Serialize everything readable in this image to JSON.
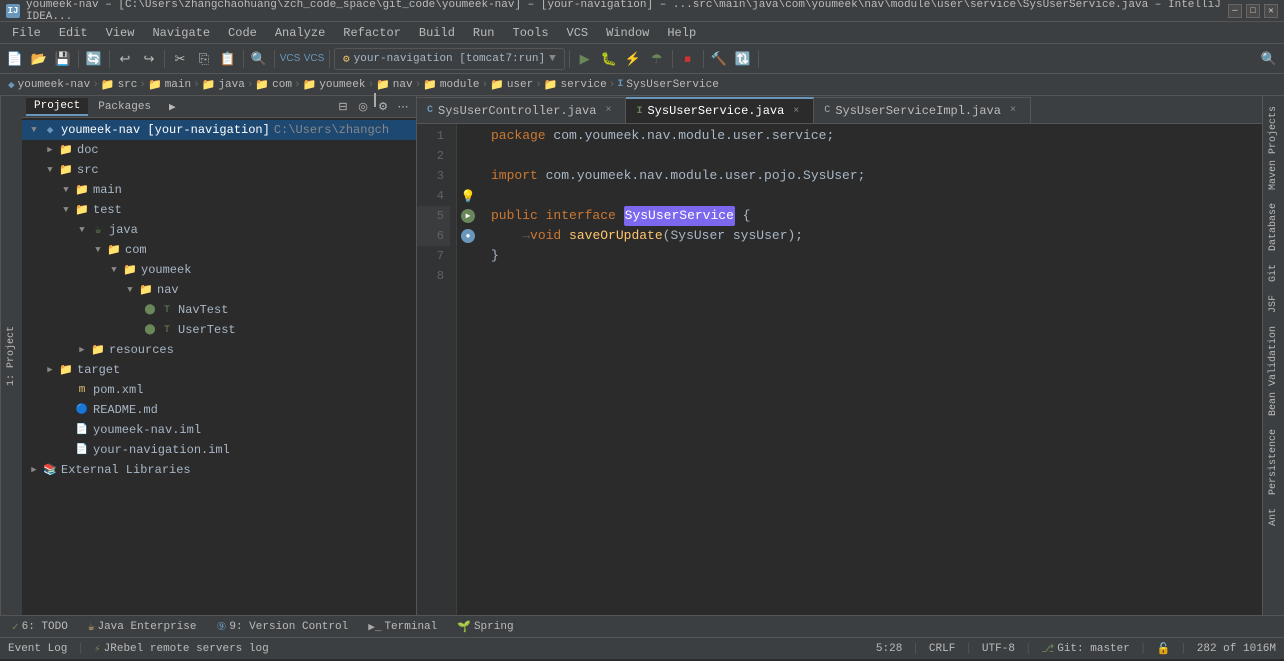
{
  "titlebar": {
    "text": "youmeek-nav – [C:\\Users\\zhangchaohuang\\zch_code_space\\git_code\\youmeek-nav] – [your-navigation] – ...src\\main\\java\\com\\youmeek\\nav\\module\\user\\service\\SysUserService.java – IntelliJ IDEA...",
    "icon": "IJ"
  },
  "menubar": {
    "items": [
      "File",
      "Edit",
      "View",
      "Navigate",
      "Code",
      "Analyze",
      "Refactor",
      "Build",
      "Run",
      "Tools",
      "VCS",
      "Window",
      "Help"
    ]
  },
  "breadcrumb": {
    "items": [
      {
        "label": "youmeek-nav",
        "type": "module"
      },
      {
        "label": "src",
        "type": "folder"
      },
      {
        "label": "main",
        "type": "folder"
      },
      {
        "label": "java",
        "type": "folder"
      },
      {
        "label": "com",
        "type": "folder"
      },
      {
        "label": "youmeek",
        "type": "folder"
      },
      {
        "label": "nav",
        "type": "folder"
      },
      {
        "label": "module",
        "type": "folder"
      },
      {
        "label": "user",
        "type": "folder"
      },
      {
        "label": "service",
        "type": "folder"
      },
      {
        "label": "SysUserService",
        "type": "class"
      }
    ]
  },
  "tabs": [
    {
      "label": "SysUserController.java",
      "type": "controller",
      "active": false,
      "closeable": true
    },
    {
      "label": "SysUserService.java",
      "type": "service",
      "active": true,
      "closeable": true
    },
    {
      "label": "SysUserServiceImpl.java",
      "type": "impl",
      "active": false,
      "closeable": true
    }
  ],
  "project_tree": {
    "root_label": "youmeek-nav [your-navigation]",
    "root_path": "C:\\Users\\zhangch",
    "items": [
      {
        "id": "youmeek-nav",
        "label": "youmeek-nav [your-navigation]",
        "type": "module",
        "depth": 0,
        "expanded": true,
        "path": "C:\\Users\\zhangch"
      },
      {
        "id": "doc",
        "label": "doc",
        "type": "folder",
        "depth": 1,
        "expanded": false
      },
      {
        "id": "src",
        "label": "src",
        "type": "folder",
        "depth": 1,
        "expanded": true
      },
      {
        "id": "main",
        "label": "main",
        "type": "folder",
        "depth": 2,
        "expanded": true
      },
      {
        "id": "test",
        "label": "test",
        "type": "folder",
        "depth": 2,
        "expanded": true
      },
      {
        "id": "java",
        "label": "java",
        "type": "src-root",
        "depth": 3,
        "expanded": true
      },
      {
        "id": "com",
        "label": "com",
        "type": "folder",
        "depth": 4,
        "expanded": true
      },
      {
        "id": "youmeek",
        "label": "youmeek",
        "type": "folder",
        "depth": 5,
        "expanded": true
      },
      {
        "id": "nav",
        "label": "nav",
        "type": "folder",
        "depth": 6,
        "expanded": true
      },
      {
        "id": "NavTest",
        "label": "NavTest",
        "type": "java-test",
        "depth": 7,
        "expanded": false
      },
      {
        "id": "UserTest",
        "label": "UserTest",
        "type": "java-test",
        "depth": 7,
        "expanded": false
      },
      {
        "id": "resources",
        "label": "resources",
        "type": "folder",
        "depth": 3,
        "expanded": false
      },
      {
        "id": "target",
        "label": "target",
        "type": "folder",
        "depth": 1,
        "expanded": false
      },
      {
        "id": "pom.xml",
        "label": "pom.xml",
        "type": "xml",
        "depth": 1,
        "expanded": false
      },
      {
        "id": "README.md",
        "label": "README.md",
        "type": "md",
        "depth": 1,
        "expanded": false
      },
      {
        "id": "youmeek-nav.iml",
        "label": "youmeek-nav.iml",
        "type": "iml",
        "depth": 1,
        "expanded": false
      },
      {
        "id": "your-navigation.iml",
        "label": "your-navigation.iml",
        "type": "iml",
        "depth": 1,
        "expanded": false
      },
      {
        "id": "External Libraries",
        "label": "External Libraries",
        "type": "ext",
        "depth": 0,
        "expanded": false
      }
    ]
  },
  "code": {
    "lines": [
      {
        "num": 1,
        "content": "package com.youmeek.nav.module.user.service;",
        "tokens": [
          {
            "t": "kw",
            "v": "package"
          },
          {
            "t": "txt",
            "v": " com.youmeek.nav.module.user.service;"
          }
        ]
      },
      {
        "num": 2,
        "content": "",
        "tokens": []
      },
      {
        "num": 3,
        "content": "import com.youmeek.nav.module.user.pojo.SysUser;",
        "tokens": [
          {
            "t": "kw",
            "v": "import"
          },
          {
            "t": "txt",
            "v": " com.youmeek.nav.module.user.pojo.SysUser;"
          }
        ]
      },
      {
        "num": 4,
        "content": "",
        "tokens": []
      },
      {
        "num": 5,
        "content": "public interface SysUserService {",
        "tokens": [
          {
            "t": "kw",
            "v": "public"
          },
          {
            "t": "txt",
            "v": " "
          },
          {
            "t": "kw",
            "v": "interface"
          },
          {
            "t": "txt",
            "v": " "
          },
          {
            "t": "hl",
            "v": "SysUserService"
          },
          {
            "t": "txt",
            "v": " {"
          }
        ],
        "annotation": "run"
      },
      {
        "num": 6,
        "content": "    void saveOrUpdate(SysUser sysUser);",
        "tokens": [
          {
            "t": "arrow",
            "v": "    "
          },
          {
            "t": "kw",
            "v": "void"
          },
          {
            "t": "txt",
            "v": " "
          },
          {
            "t": "method",
            "v": "saveOrUpdate"
          },
          {
            "t": "txt",
            "v": "(SysUser sysUser);"
          }
        ],
        "annotation": "debug"
      },
      {
        "num": 7,
        "content": "}",
        "tokens": [
          {
            "t": "txt",
            "v": "}"
          }
        ]
      },
      {
        "num": 8,
        "content": "",
        "tokens": []
      }
    ]
  },
  "toolbar": {
    "run_config": "your-navigation [tomcat7:run]",
    "buttons": [
      "new",
      "open",
      "save-all",
      "sync",
      "undo",
      "redo",
      "cut",
      "copy",
      "paste",
      "find",
      "replace",
      "run",
      "debug",
      "profile",
      "coverage",
      "stop",
      "build",
      "rebuild"
    ]
  },
  "statusbar": {
    "position": "5:28",
    "line_ending": "CRLF",
    "encoding": "UTF-8",
    "indent": "4",
    "git": "Git: master",
    "readonly": false,
    "event_log": "Event Log",
    "jrebel": "JRebel remote servers log",
    "line_col": "282 of 1016M"
  },
  "bottombar": {
    "tabs": [
      {
        "label": "6: TODO",
        "icon": "todo"
      },
      {
        "label": "Java Enterprise",
        "icon": "java"
      },
      {
        "label": "9: Version Control",
        "icon": "vcs"
      },
      {
        "label": "Terminal",
        "icon": "terminal"
      },
      {
        "label": "Spring",
        "icon": "spring"
      }
    ]
  },
  "right_panel": {
    "items": [
      "Maven Projects",
      "Database",
      "Git",
      "JSF",
      "Bean Validation",
      "Persistence",
      "Ant"
    ]
  },
  "left_panel": {
    "label": "1: Project"
  },
  "icons": {
    "folder": "📁",
    "java": "☕",
    "run": "▶",
    "debug": "🐛",
    "close": "×"
  }
}
